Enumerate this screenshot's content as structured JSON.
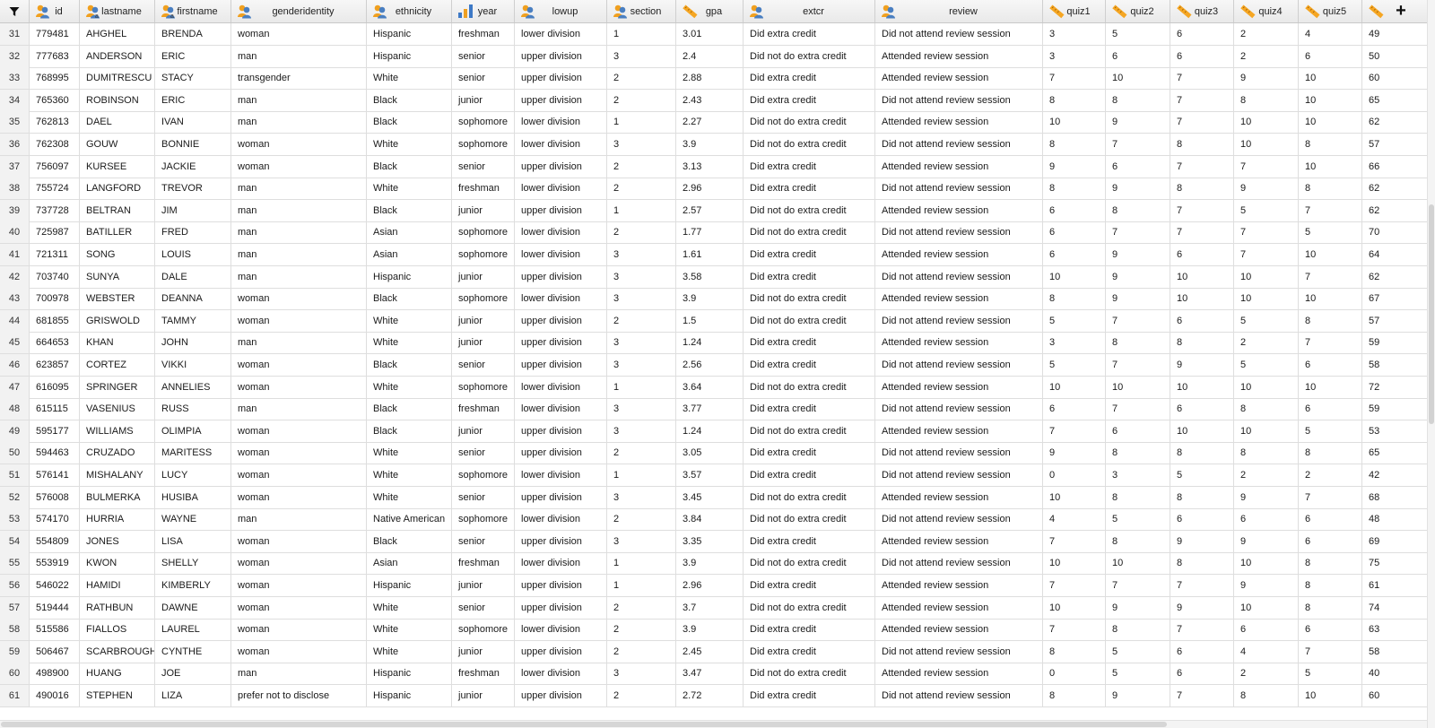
{
  "columns": [
    {
      "key": "id",
      "label": "id",
      "icon": "nominal-icon"
    },
    {
      "key": "lastname",
      "label": "lastname",
      "icon": "nominal-text-icon"
    },
    {
      "key": "firstname",
      "label": "firstname",
      "icon": "nominal-text-icon"
    },
    {
      "key": "genderidentity",
      "label": "genderidentity",
      "icon": "nominal-icon"
    },
    {
      "key": "ethnicity",
      "label": "ethnicity",
      "icon": "nominal-icon"
    },
    {
      "key": "year",
      "label": "year",
      "icon": "ordinal-icon"
    },
    {
      "key": "lowup",
      "label": "lowup",
      "icon": "nominal-icon"
    },
    {
      "key": "section",
      "label": "section",
      "icon": "nominal-icon"
    },
    {
      "key": "gpa",
      "label": "gpa",
      "icon": "scale-icon"
    },
    {
      "key": "extcr",
      "label": "extcr",
      "icon": "nominal-icon"
    },
    {
      "key": "review",
      "label": "review",
      "icon": "nominal-icon"
    },
    {
      "key": "quiz1",
      "label": "quiz1",
      "icon": "scale-icon"
    },
    {
      "key": "quiz2",
      "label": "quiz2",
      "icon": "scale-icon"
    },
    {
      "key": "quiz3",
      "label": "quiz3",
      "icon": "scale-icon"
    },
    {
      "key": "quiz4",
      "label": "quiz4",
      "icon": "scale-icon"
    },
    {
      "key": "quiz5",
      "label": "quiz5",
      "icon": "scale-icon"
    },
    {
      "key": "total",
      "label": "",
      "icon": "scale-icon"
    }
  ],
  "colors": {
    "nominal_blue": "#4a7fc1",
    "nominal_orange": "#f0a020",
    "ruler": "#f5a623",
    "bar_blue": "#3d79c6",
    "bar_orange": "#f0a020"
  },
  "rows": [
    [
      "31",
      "779481",
      "AHGHEL",
      "BRENDA",
      "woman",
      "Hispanic",
      "freshman",
      "lower division",
      "1",
      "3.01",
      "Did extra credit",
      "Did not attend review session",
      "3",
      "5",
      "6",
      "2",
      "4",
      "49"
    ],
    [
      "32",
      "777683",
      "ANDERSON",
      "ERIC",
      "man",
      "Hispanic",
      "senior",
      "upper division",
      "3",
      "2.4",
      "Did not do extra credit",
      "Attended review session",
      "3",
      "6",
      "6",
      "2",
      "6",
      "50"
    ],
    [
      "33",
      "768995",
      "DUMITRESCU",
      "STACY",
      "transgender",
      "White",
      "senior",
      "upper division",
      "2",
      "2.88",
      "Did extra credit",
      "Attended review session",
      "7",
      "10",
      "7",
      "9",
      "10",
      "60"
    ],
    [
      "34",
      "765360",
      "ROBINSON",
      "ERIC",
      "man",
      "Black",
      "junior",
      "upper division",
      "2",
      "2.43",
      "Did extra credit",
      "Did not attend review session",
      "8",
      "8",
      "7",
      "8",
      "10",
      "65"
    ],
    [
      "35",
      "762813",
      "DAEL",
      "IVAN",
      "man",
      "Black",
      "sophomore",
      "lower division",
      "1",
      "2.27",
      "Did not do extra credit",
      "Attended review session",
      "10",
      "9",
      "7",
      "10",
      "10",
      "62"
    ],
    [
      "36",
      "762308",
      "GOUW",
      "BONNIE",
      "woman",
      "White",
      "sophomore",
      "lower division",
      "3",
      "3.9",
      "Did not do extra credit",
      "Did not attend review session",
      "8",
      "7",
      "8",
      "10",
      "8",
      "57"
    ],
    [
      "37",
      "756097",
      "KURSEE",
      "JACKIE",
      "woman",
      "Black",
      "senior",
      "upper division",
      "2",
      "3.13",
      "Did extra credit",
      "Attended review session",
      "9",
      "6",
      "7",
      "7",
      "10",
      "66"
    ],
    [
      "38",
      "755724",
      "LANGFORD",
      "TREVOR",
      "man",
      "White",
      "freshman",
      "lower division",
      "2",
      "2.96",
      "Did extra credit",
      "Did not attend review session",
      "8",
      "9",
      "8",
      "9",
      "8",
      "62"
    ],
    [
      "39",
      "737728",
      "BELTRAN",
      "JIM",
      "man",
      "Black",
      "junior",
      "upper division",
      "1",
      "2.57",
      "Did not do extra credit",
      "Attended review session",
      "6",
      "8",
      "7",
      "5",
      "7",
      "62"
    ],
    [
      "40",
      "725987",
      "BATILLER",
      "FRED",
      "man",
      "Asian",
      "sophomore",
      "lower division",
      "2",
      "1.77",
      "Did not do extra credit",
      "Did not attend review session",
      "6",
      "7",
      "7",
      "7",
      "5",
      "70"
    ],
    [
      "41",
      "721311",
      "SONG",
      "LOUIS",
      "man",
      "Asian",
      "sophomore",
      "lower division",
      "3",
      "1.61",
      "Did extra credit",
      "Attended review session",
      "6",
      "9",
      "6",
      "7",
      "10",
      "64"
    ],
    [
      "42",
      "703740",
      "SUNYA",
      "DALE",
      "man",
      "Hispanic",
      "junior",
      "upper division",
      "3",
      "3.58",
      "Did extra credit",
      "Did not attend review session",
      "10",
      "9",
      "10",
      "10",
      "7",
      "62"
    ],
    [
      "43",
      "700978",
      "WEBSTER",
      "DEANNA",
      "woman",
      "Black",
      "sophomore",
      "lower division",
      "3",
      "3.9",
      "Did not do extra credit",
      "Attended review session",
      "8",
      "9",
      "10",
      "10",
      "10",
      "67"
    ],
    [
      "44",
      "681855",
      "GRISWOLD",
      "TAMMY",
      "woman",
      "White",
      "junior",
      "upper division",
      "2",
      "1.5",
      "Did not do extra credit",
      "Did not attend review session",
      "5",
      "7",
      "6",
      "5",
      "8",
      "57"
    ],
    [
      "45",
      "664653",
      "KHAN",
      "JOHN",
      "man",
      "White",
      "junior",
      "upper division",
      "3",
      "1.24",
      "Did extra credit",
      "Attended review session",
      "3",
      "8",
      "8",
      "2",
      "7",
      "59"
    ],
    [
      "46",
      "623857",
      "CORTEZ",
      "VIKKI",
      "woman",
      "Black",
      "senior",
      "upper division",
      "3",
      "2.56",
      "Did extra credit",
      "Did not attend review session",
      "5",
      "7",
      "9",
      "5",
      "6",
      "58"
    ],
    [
      "47",
      "616095",
      "SPRINGER",
      "ANNELIES",
      "woman",
      "White",
      "sophomore",
      "lower division",
      "1",
      "3.64",
      "Did not do extra credit",
      "Attended review session",
      "10",
      "10",
      "10",
      "10",
      "10",
      "72"
    ],
    [
      "48",
      "615115",
      "VASENIUS",
      "RUSS",
      "man",
      "Black",
      "freshman",
      "lower division",
      "3",
      "3.77",
      "Did extra credit",
      "Did not attend review session",
      "6",
      "7",
      "6",
      "8",
      "6",
      "59"
    ],
    [
      "49",
      "595177",
      "WILLIAMS",
      "OLIMPIA",
      "woman",
      "Black",
      "junior",
      "upper division",
      "3",
      "1.24",
      "Did not do extra credit",
      "Attended review session",
      "7",
      "6",
      "10",
      "10",
      "5",
      "53"
    ],
    [
      "50",
      "594463",
      "CRUZADO",
      "MARITESS",
      "woman",
      "White",
      "senior",
      "upper division",
      "2",
      "3.05",
      "Did extra credit",
      "Did not attend review session",
      "9",
      "8",
      "8",
      "8",
      "8",
      "65"
    ],
    [
      "51",
      "576141",
      "MISHALANY",
      "LUCY",
      "woman",
      "White",
      "sophomore",
      "lower division",
      "1",
      "3.57",
      "Did extra credit",
      "Did not attend review session",
      "0",
      "3",
      "5",
      "2",
      "2",
      "42"
    ],
    [
      "52",
      "576008",
      "BULMERKA",
      "HUSIBA",
      "woman",
      "White",
      "senior",
      "upper division",
      "3",
      "3.45",
      "Did not do extra credit",
      "Attended review session",
      "10",
      "8",
      "8",
      "9",
      "7",
      "68"
    ],
    [
      "53",
      "574170",
      "HURRIA",
      "WAYNE",
      "man",
      "Native American",
      "sophomore",
      "lower division",
      "2",
      "3.84",
      "Did not do extra credit",
      "Did not attend review session",
      "4",
      "5",
      "6",
      "6",
      "6",
      "48"
    ],
    [
      "54",
      "554809",
      "JONES",
      "LISA",
      "woman",
      "Black",
      "senior",
      "upper division",
      "3",
      "3.35",
      "Did extra credit",
      "Attended review session",
      "7",
      "8",
      "9",
      "9",
      "6",
      "69"
    ],
    [
      "55",
      "553919",
      "KWON",
      "SHELLY",
      "woman",
      "Asian",
      "freshman",
      "lower division",
      "1",
      "3.9",
      "Did not do extra credit",
      "Did not attend review session",
      "10",
      "10",
      "8",
      "10",
      "8",
      "75"
    ],
    [
      "56",
      "546022",
      "HAMIDI",
      "KIMBERLY",
      "woman",
      "Hispanic",
      "junior",
      "upper division",
      "1",
      "2.96",
      "Did extra credit",
      "Attended review session",
      "7",
      "7",
      "7",
      "9",
      "8",
      "61"
    ],
    [
      "57",
      "519444",
      "RATHBUN",
      "DAWNE",
      "woman",
      "White",
      "senior",
      "upper division",
      "2",
      "3.7",
      "Did not do extra credit",
      "Attended review session",
      "10",
      "9",
      "9",
      "10",
      "8",
      "74"
    ],
    [
      "58",
      "515586",
      "FIALLOS",
      "LAUREL",
      "woman",
      "White",
      "sophomore",
      "lower division",
      "2",
      "3.9",
      "Did extra credit",
      "Attended review session",
      "7",
      "8",
      "7",
      "6",
      "6",
      "63"
    ],
    [
      "59",
      "506467",
      "SCARBROUGH",
      "CYNTHE",
      "woman",
      "White",
      "junior",
      "upper division",
      "2",
      "2.45",
      "Did extra credit",
      "Did not attend review session",
      "8",
      "5",
      "6",
      "4",
      "7",
      "58"
    ],
    [
      "60",
      "498900",
      "HUANG",
      "JOE",
      "man",
      "Hispanic",
      "freshman",
      "lower division",
      "3",
      "3.47",
      "Did not do extra credit",
      "Attended review session",
      "0",
      "5",
      "6",
      "2",
      "5",
      "40"
    ],
    [
      "61",
      "490016",
      "STEPHEN",
      "LIZA",
      "prefer not to disclose",
      "Hispanic",
      "junior",
      "upper division",
      "2",
      "2.72",
      "Did extra credit",
      "Did not attend review session",
      "8",
      "9",
      "7",
      "8",
      "10",
      "60"
    ]
  ]
}
